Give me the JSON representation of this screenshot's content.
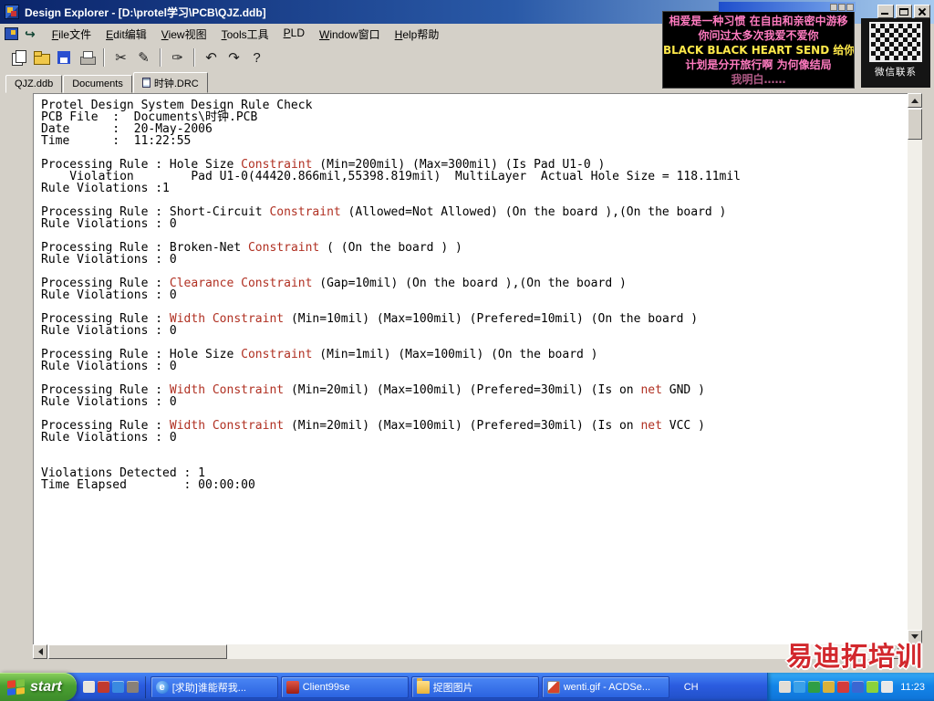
{
  "window": {
    "title": "Design Explorer - [D:\\protel学习\\PCB\\QJZ.ddb]"
  },
  "menu_bar": {
    "arrow_glyph": "↪",
    "items": [
      {
        "name": "file",
        "label": "File文件"
      },
      {
        "name": "edit",
        "label": "Edit编辑"
      },
      {
        "name": "view",
        "label": "View视图"
      },
      {
        "name": "tools",
        "label": "Tools工具"
      },
      {
        "name": "pld",
        "label": "PLD"
      },
      {
        "name": "window",
        "label": "Window窗口"
      },
      {
        "name": "help",
        "label": "Help帮助"
      }
    ]
  },
  "toolbar": {
    "icons": [
      {
        "name": "new-document-icon",
        "glyph": "pages"
      },
      {
        "name": "open-folder-icon",
        "glyph": "folder"
      },
      {
        "name": "save-icon",
        "glyph": "floppy"
      },
      {
        "name": "print-icon",
        "glyph": "printer"
      },
      {
        "name": "knife-icon",
        "glyph": "✂",
        "sep_before": true
      },
      {
        "name": "pencil-icon",
        "glyph": "✎"
      },
      {
        "name": "brush-icon",
        "glyph": "✑",
        "sep_before": true
      },
      {
        "name": "undo-icon",
        "glyph": "↶",
        "sep_before": true
      },
      {
        "name": "redo-icon",
        "glyph": "↷"
      },
      {
        "name": "help-icon",
        "glyph": "?"
      }
    ]
  },
  "tabs": [
    {
      "name": "tab-qjz-ddb",
      "label": "QJZ.ddb",
      "active": false,
      "icon": false
    },
    {
      "name": "tab-documents",
      "label": "Documents",
      "active": false,
      "icon": false
    },
    {
      "name": "tab-clock-drc",
      "label": "时钟.DRC",
      "active": true,
      "icon": true
    }
  ],
  "report": {
    "red_color": "#b03022",
    "lines": [
      {
        "s": [
          {
            "t": "Protel Design System Design Rule Check"
          }
        ]
      },
      {
        "s": [
          {
            "t": "PCB File  :  Documents\\时钟.PCB"
          }
        ]
      },
      {
        "s": [
          {
            "t": "Date      :  20-May-2006"
          }
        ]
      },
      {
        "s": [
          {
            "t": "Time      :  11:22:55"
          }
        ]
      },
      {
        "s": []
      },
      {
        "s": [
          {
            "t": "Processing Rule : Hole Size "
          },
          {
            "t": "Constraint",
            "c": "r"
          },
          {
            "t": " (Min=200mil) (Max=300mil) (Is Pad U1-0 )"
          }
        ]
      },
      {
        "s": [
          {
            "t": "    Violation        Pad U1-0(44420.866mil,55398.819mil)  MultiLayer  Actual Hole Size = 118.11mil"
          }
        ]
      },
      {
        "s": [
          {
            "t": "Rule Violations :1"
          }
        ]
      },
      {
        "s": []
      },
      {
        "s": [
          {
            "t": "Processing Rule : Short-Circuit "
          },
          {
            "t": "Constraint",
            "c": "r"
          },
          {
            "t": " (Allowed=Not Allowed) (On the board ),(On the board )"
          }
        ]
      },
      {
        "s": [
          {
            "t": "Rule Violations : 0"
          }
        ]
      },
      {
        "s": []
      },
      {
        "s": [
          {
            "t": "Processing Rule : Broken-Net "
          },
          {
            "t": "Constraint",
            "c": "r"
          },
          {
            "t": " ( (On the board ) )"
          }
        ]
      },
      {
        "s": [
          {
            "t": "Rule Violations : 0"
          }
        ]
      },
      {
        "s": []
      },
      {
        "s": [
          {
            "t": "Processing Rule : "
          },
          {
            "t": "Clearance Constraint",
            "c": "r"
          },
          {
            "t": " (Gap=10mil) (On the board ),(On the board )"
          }
        ]
      },
      {
        "s": [
          {
            "t": "Rule Violations : 0"
          }
        ]
      },
      {
        "s": []
      },
      {
        "s": [
          {
            "t": "Processing Rule : "
          },
          {
            "t": "Width Constraint",
            "c": "r"
          },
          {
            "t": " (Min=10mil) (Max=100mil) (Prefered=10mil) (On the board )"
          }
        ]
      },
      {
        "s": [
          {
            "t": "Rule Violations : 0"
          }
        ]
      },
      {
        "s": []
      },
      {
        "s": [
          {
            "t": "Processing Rule : Hole Size "
          },
          {
            "t": "Constraint",
            "c": "r"
          },
          {
            "t": " (Min=1mil) (Max=100mil) (On the board )"
          }
        ]
      },
      {
        "s": [
          {
            "t": "Rule Violations : 0"
          }
        ]
      },
      {
        "s": []
      },
      {
        "s": [
          {
            "t": "Processing Rule : "
          },
          {
            "t": "Width Constraint",
            "c": "r"
          },
          {
            "t": " (Min=20mil) (Max=100mil) (Prefered=30mil) (Is on "
          },
          {
            "t": "net",
            "c": "r"
          },
          {
            "t": " GND )"
          }
        ]
      },
      {
        "s": [
          {
            "t": "Rule Violations : 0"
          }
        ]
      },
      {
        "s": []
      },
      {
        "s": [
          {
            "t": "Processing Rule : "
          },
          {
            "t": "Width Constraint",
            "c": "r"
          },
          {
            "t": " (Min=20mil) (Max=100mil) (Prefered=30mil) (Is on "
          },
          {
            "t": "net",
            "c": "r"
          },
          {
            "t": " VCC )"
          }
        ]
      },
      {
        "s": [
          {
            "t": "Rule Violations : 0"
          }
        ]
      },
      {
        "s": []
      },
      {
        "s": []
      },
      {
        "s": [
          {
            "t": "Violations Detected : 1"
          }
        ]
      },
      {
        "s": [
          {
            "t": "Time Elapsed        : 00:00:00"
          }
        ]
      }
    ]
  },
  "lyrics_overlay": {
    "lines": [
      {
        "text": "相爱是一种习惯 在自由和亲密中游移",
        "color": "#ff7bc0"
      },
      {
        "text": "你问过太多次我爱不爱你",
        "color": "#ff7bc0"
      },
      {
        "text": "BLACK BLACK HEART SEND 给你我的心",
        "color": "#ffe94a",
        "bold": true
      },
      {
        "text": "计划是分开旅行啊 为何像结局",
        "color": "#ff7bc0"
      },
      {
        "text": "我明白……",
        "color": "#b05a86"
      }
    ]
  },
  "qr_watermark": {
    "label": "微信联系"
  },
  "corner_watermark": {
    "text": "易迪拓培训",
    "color": "#d2282d"
  },
  "taskbar": {
    "start_label": "start",
    "quick_launch": [
      {
        "name": "quick-launch-icon-1",
        "color": "#e8e4dc"
      },
      {
        "name": "quick-launch-icon-2",
        "color": "#c03a2e"
      },
      {
        "name": "quick-launch-icon-3",
        "color": "#3a8ae0"
      },
      {
        "name": "quick-launch-icon-4",
        "color": "#888078"
      }
    ],
    "buttons": [
      {
        "name": "task-button-forum-post",
        "icon": "ie",
        "label": "[求助]谁能帮我..."
      },
      {
        "name": "task-button-client99se",
        "icon": "redapp",
        "label": "Client99se"
      },
      {
        "name": "task-button-capture-folder",
        "icon": "folder",
        "label": "捉图图片"
      },
      {
        "name": "task-button-acdsee",
        "icon": "acdsee",
        "label": "wenti.gif - ACDSe..."
      }
    ],
    "language_indicator": "CH",
    "tray_icons": [
      {
        "name": "tray-icon-1",
        "color": "#e2ded6"
      },
      {
        "name": "tray-icon-2",
        "color": "#3aa0e8"
      },
      {
        "name": "tray-icon-3",
        "color": "#2f9e44"
      },
      {
        "name": "tray-icon-4",
        "color": "#d8b13a"
      },
      {
        "name": "tray-icon-5",
        "color": "#d23b3b"
      },
      {
        "name": "tray-icon-6",
        "color": "#3a66d2"
      },
      {
        "name": "tray-icon-7",
        "color": "#8ad23b"
      },
      {
        "name": "tray-icon-8",
        "color": "#e8e8e8"
      }
    ],
    "clock": "11:23"
  }
}
